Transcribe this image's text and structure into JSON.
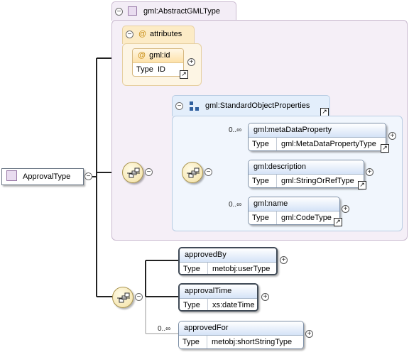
{
  "root": {
    "label": "ApprovalType"
  },
  "abstract_type": {
    "title": "gml:AbstractGMLType"
  },
  "attributes": {
    "title": "attributes",
    "at_symbol": "@",
    "items": [
      {
        "name": "gml:id",
        "type_key": "Type",
        "type_value": "ID"
      }
    ]
  },
  "standard_props": {
    "title": "gml:StandardObjectProperties",
    "elements": [
      {
        "name": "gml:metaDataProperty",
        "type_key": "Type",
        "type_value": "gml:MetaDataPropertyType",
        "occurrence": "0..∞"
      },
      {
        "name": "gml:description",
        "type_key": "Type",
        "type_value": "gml:StringOrRefType",
        "occurrence": ""
      },
      {
        "name": "gml:name",
        "type_key": "Type",
        "type_value": "gml:CodeType",
        "occurrence": "0..∞"
      }
    ]
  },
  "sequence_elements": [
    {
      "name": "approvedBy",
      "type_key": "Type",
      "type_value": "metobj:userType",
      "occurrence": ""
    },
    {
      "name": "approvalTime",
      "type_key": "Type",
      "type_value": "xs:dateTime",
      "occurrence": ""
    },
    {
      "name": "approvedFor",
      "type_key": "Type",
      "type_value": "metobj:shortStringType",
      "occurrence": "0..∞"
    }
  ],
  "glyphs": {
    "collapse": "−",
    "expand": "+",
    "link": "↗"
  },
  "colors": {
    "type_bg": "#f5eff7",
    "attr_bg": "#fdf5e4",
    "group_bg": "#f1f6fd",
    "header_grad": "#d5e3f7"
  }
}
